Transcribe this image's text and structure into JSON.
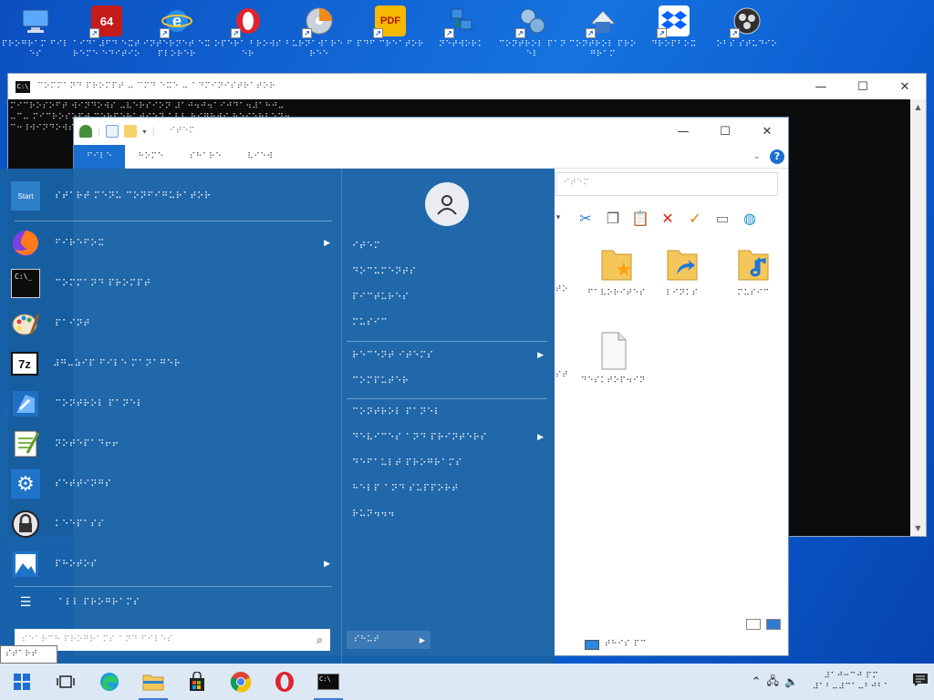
{
  "desktop": {
    "icons": [
      {
        "label": "⠏⠗⠕⠛⠗⠁⠍ ⠋⠊⠇⠑⠎",
        "icon": "computer-icon"
      },
      {
        "label": "⠁⠊⠙⠁⠼⠋⠙ ⠑⠭⠞⠗⠑⠍⠑ ⠑⠙⠊⠞⠊⠕⠝",
        "icon": "aida64-icon"
      },
      {
        "label": "⠊⠝⠞⠑⠗⠝⠑⠞ ⠑⠭⠏⠇⠕⠗⠑⠗",
        "icon": "internet-explorer-icon"
      },
      {
        "label": "⠕⠏⠑⠗⠁ ⠃⠗⠕⠺⠎⠑⠗",
        "icon": "opera-icon"
      },
      {
        "label": "⠃⠥⠗⠝⠁⠺⠁⠗⠑ ⠋⠗⠑⠑",
        "icon": "burnaware-icon"
      },
      {
        "label": "⠏⠙⠋ ⠉⠗⠑⠁⠞⠕⠗",
        "icon": "pdf-icon"
      },
      {
        "label": "⠝⠑⠞⠺⠕⠗⠅",
        "icon": "network-icon"
      },
      {
        "label": "⠉⠕⠝⠞⠗⠕⠇ ⠏⠁⠝⠑⠇",
        "icon": "control-panel-icon"
      },
      {
        "label": "⠉⠕⠝⠞⠗⠕⠇ ⠏⠗⠕⠛⠗⠁⠍",
        "icon": "control-icon"
      },
      {
        "label": "⠙⠗⠕⠏⠃⠕⠭",
        "icon": "dropbox-icon"
      },
      {
        "label": "⠕⠃⠎ ⠎⠞⠥⠙⠊⠕",
        "icon": "obs-studio-icon"
      }
    ]
  },
  "terminal": {
    "title": "⠉⠕⠍⠍⠁⠝⠙ ⠏⠗⠕⠍⠏⠞ ⠤ ⠉⠍⠙ ⠑⠭⠑ ⠤ ⠁⠙⠍⠊⠝⠊⠎⠞⠗⠁⠞⠕⠗",
    "lines": [
      "⠍⠊⠉⠗⠕⠎⠕⠋⠞ ⠺⠊⠝⠙⠕⠺⠎ ⠤⠧⠑⠗⠎⠊⠕⠝ ⠼⠁⠚⠲⠚⠲⠁⠊⠚⠙⠁⠲⠼⠁⠓⠚⠤",
      "⠤⠉⠤ ⠍⠊⠉⠗⠕⠎⠕⠋⠞ ⠉⠕⠗⠏⠕⠗⠁⠞⠊⠕⠝ ⠁⠇⠇ ⠗⠊⠛⠓⠞⠎ ⠗⠑⠎⠑⠗⠧⠑⠙⠲",
      "",
      "⠉⠒⠸⠺⠊⠝⠙⠕⠺⠎⠸⠎⠽⠎⠞⠑⠍⠼⠉⠃⠕"
    ],
    "controls": {
      "minimize": "—",
      "maximize": "☐",
      "close": "✕"
    }
  },
  "explorer": {
    "title": "⠊⠞⠑⠍",
    "tabs": [
      "⠋⠊⠇⠑",
      "⠓⠕⠍⠑",
      "⠎⠓⠁⠗⠑",
      "⠧⠊⠑⠺"
    ],
    "address": "⠊⠞⠑⠍",
    "help": "?",
    "items": [
      {
        "label": "⠋⠁⠧⠕⠗⠊⠞⠑⠎",
        "icon": "favorites-folder-icon"
      },
      {
        "label": "⠇⠊⠝⠅⠎",
        "icon": "links-folder-icon"
      },
      {
        "label": "⠍⠥⠎⠊⠉",
        "icon": "music-folder-icon"
      },
      {
        "label": "⠙⠑⠎⠅⠞⠕⠏⠲⠊⠝⠊",
        "icon": "document-icon"
      }
    ],
    "partial_labels": [
      "⠞⠕",
      "⠎⠞"
    ],
    "status": "⠞⠓⠊⠎ ⠏⠉",
    "controls": {
      "minimize": "—",
      "maximize": "☐",
      "close": "✕"
    }
  },
  "startmenu": {
    "header": {
      "label": "⠎⠞⠁⠗⠞ ⠍⠑⠝⠥ ⠉⠕⠝⠋⠊⠛⠥⠗⠁⠞⠕⠗",
      "icon_text": "Start"
    },
    "items": [
      {
        "label": "⠋⠊⠗⠑⠋⠕⠭",
        "icon": "firefox-icon",
        "submenu": true
      },
      {
        "label": "⠉⠕⠍⠍⠁⠝⠙ ⠏⠗⠕⠍⠏⠞",
        "icon": "command-prompt-icon",
        "submenu": false
      },
      {
        "label": "⠏⠁⠊⠝⠞",
        "icon": "paint-icon",
        "submenu": false
      },
      {
        "label": "⠼⠛⠤⠵⠊⠏ ⠋⠊⠇⠑ ⠍⠁⠝⠁⠛⠑⠗",
        "icon": "7zip-icon",
        "submenu": false
      },
      {
        "label": "⠉⠕⠝⠞⠗⠕⠇ ⠏⠁⠝⠑⠇",
        "icon": "control-panel-icon",
        "submenu": false
      },
      {
        "label": "⠝⠕⠞⠑⠏⠁⠙⠖⠖",
        "icon": "notepad-plus-icon",
        "submenu": false
      },
      {
        "label": "⠎⠑⠞⠞⠊⠝⠛⠎",
        "icon": "settings-gear-icon",
        "submenu": false
      },
      {
        "label": "⠅⠑⠑⠏⠁⠎⠎",
        "icon": "keepass-lock-icon",
        "submenu": false
      },
      {
        "label": "⠏⠓⠕⠞⠕⠎",
        "icon": "photos-icon",
        "submenu": true
      }
    ],
    "all_programs": "⠁⠇⠇ ⠏⠗⠕⠛⠗⠁⠍⠎",
    "search_placeholder": "⠎⠑⠁⠗⠉⠓ ⠏⠗⠕⠛⠗⠁⠍⠎ ⠁⠝⠙ ⠋⠊⠇⠑⠎",
    "right_links": [
      {
        "label": "⠊⠞⠑⠍",
        "submenu": false
      },
      {
        "label": "⠙⠕⠉⠥⠍⠑⠝⠞⠎",
        "submenu": false
      },
      {
        "label": "⠏⠊⠉⠞⠥⠗⠑⠎",
        "submenu": false
      },
      {
        "label": "⠍⠥⠎⠊⠉",
        "submenu": false
      },
      {
        "label": "⠗⠑⠉⠑⠝⠞ ⠊⠞⠑⠍⠎",
        "submenu": true
      },
      {
        "label": "⠉⠕⠍⠏⠥⠞⠑⠗",
        "submenu": false
      },
      {
        "label": "⠉⠕⠝⠞⠗⠕⠇ ⠏⠁⠝⠑⠇",
        "submenu": false
      },
      {
        "label": "⠙⠑⠧⠊⠉⠑⠎ ⠁⠝⠙ ⠏⠗⠊⠝⠞⠑⠗⠎",
        "submenu": true
      },
      {
        "label": "⠙⠑⠋⠁⠥⠇⠞ ⠏⠗⠕⠛⠗⠁⠍⠎",
        "submenu": false
      },
      {
        "label": "⠓⠑⠇⠏ ⠁⠝⠙ ⠎⠥⠏⠏⠕⠗⠞",
        "submenu": false
      },
      {
        "label": "⠗⠥⠝⠲⠲⠲",
        "submenu": false
      }
    ],
    "shutdown_label": "⠎⠓⠥⠞",
    "tooltip": "⠎⠞⠁⠗⠞"
  },
  "taskbar": {
    "apps": [
      {
        "icon": "windows-start-icon",
        "label": "⊞"
      },
      {
        "icon": "task-view-icon",
        "label": "⧉"
      },
      {
        "icon": "edge-icon",
        "label": "e"
      },
      {
        "icon": "file-explorer-icon",
        "label": "▬"
      },
      {
        "icon": "store-icon",
        "label": "▦"
      },
      {
        "icon": "chrome-icon",
        "label": "◉"
      },
      {
        "icon": "opera-icon",
        "label": "O"
      },
      {
        "icon": "terminal-icon",
        "label": "C:\\"
      }
    ],
    "tray_chevron": "^",
    "tray_network": "▭",
    "tray_volume": "🔊",
    "clock_time": "⠼⠁⠚⠒⠉⠚ ⠏⠍",
    "clock_date": "⠼⠁⠃⠤⠼⠉⠁⠤⠃⠚⠃⠁",
    "notification": "▤"
  },
  "colors": {
    "desktop_top": "#0b4fc0",
    "startmenu_bg": "#1862a8",
    "taskbar_bg": "#dce8f4",
    "accent": "#1a6fd1"
  }
}
